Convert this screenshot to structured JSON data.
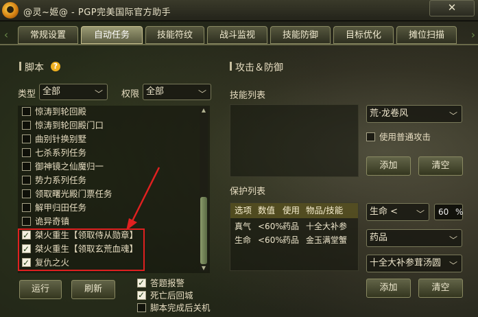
{
  "window": {
    "title": "@灵~姬@ - PGP完美国际官方助手",
    "close_glyph": "✕"
  },
  "tabs": [
    {
      "label": "常规设置",
      "active": false
    },
    {
      "label": "自动任务",
      "active": true
    },
    {
      "label": "技能符纹",
      "active": false
    },
    {
      "label": "战斗监视",
      "active": false
    },
    {
      "label": "技能防御",
      "active": false
    },
    {
      "label": "目标优化",
      "active": false
    },
    {
      "label": "摊位扫描",
      "active": false
    }
  ],
  "nav": {
    "prev": "‹",
    "next": "›"
  },
  "script_section": {
    "title": "脚本",
    "help": "?",
    "type_label": "类型",
    "type_value": "全部",
    "perm_label": "权限",
    "perm_value": "全部",
    "items": [
      {
        "label": "惊涛到轮回殿",
        "checked": false
      },
      {
        "label": "惊涛到轮回殿门口",
        "checked": false
      },
      {
        "label": "曲别针换别墅",
        "checked": false
      },
      {
        "label": "七杀系列任务",
        "checked": false
      },
      {
        "label": "御神镜之仙魔归一",
        "checked": false
      },
      {
        "label": "势力系列任务",
        "checked": false
      },
      {
        "label": "领取曙光殿门票任务",
        "checked": false
      },
      {
        "label": "解甲归田任务",
        "checked": false
      },
      {
        "label": "诡异奇镇",
        "checked": false
      },
      {
        "label": "桀火重生【领取侍从勋章】",
        "checked": true
      },
      {
        "label": "桀火重生【领取玄荒血魂】",
        "checked": true
      },
      {
        "label": "复仇之火",
        "checked": true
      }
    ],
    "scroll_position": 0.55,
    "run_button": "运行",
    "refresh_button": "刷新",
    "options": [
      {
        "label": "答题报警",
        "checked": true
      },
      {
        "label": "死亡后回城",
        "checked": true
      },
      {
        "label": "脚本完成后关机",
        "checked": false
      }
    ]
  },
  "attack_section": {
    "title": "攻击＆防御",
    "skill_list_label": "技能列表",
    "skill_select": "荒·龙卷风",
    "normal_attack_label": "使用普通攻击",
    "normal_attack_checked": false,
    "add_button": "添加",
    "clear_button": "清空",
    "protect_list_label": "保护列表",
    "protect_columns": [
      "选项",
      "数值",
      "使用",
      "物品/技能"
    ],
    "protect_rows": [
      [
        "真气",
        "<60%",
        "药品",
        "十全大补参"
      ],
      [
        "生命",
        "<60%",
        "药品",
        "金玉满堂蟹"
      ]
    ],
    "protect_attr_select": "生命 <",
    "protect_value": "60",
    "protect_unit": "%",
    "protect_type_select": "药品",
    "protect_item_select": "十全大补参茸汤圆",
    "add_button2": "添加",
    "clear_button2": "清空"
  },
  "icons": {
    "chevron": "chevron-down-icon",
    "close": "close-icon",
    "help": "help-icon"
  }
}
